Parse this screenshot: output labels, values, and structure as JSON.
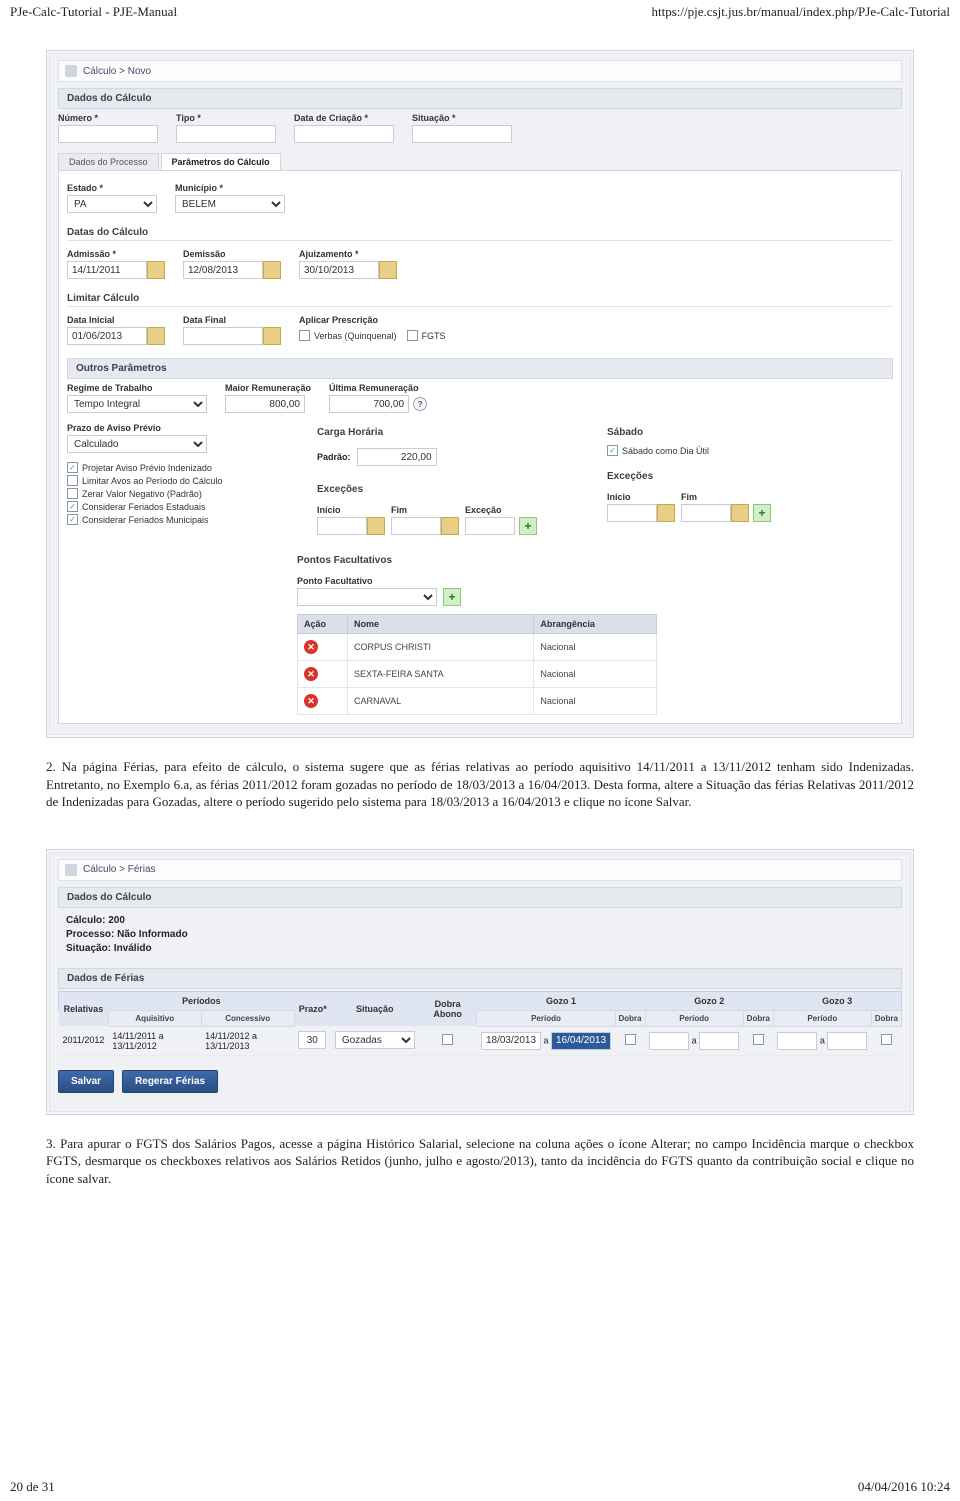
{
  "header": {
    "left": "PJe-Calc-Tutorial - PJE-Manual",
    "right": "https://pje.csjt.jus.br/manual/index.php/PJe-Calc-Tutorial"
  },
  "footer": {
    "left": "20 de 31",
    "right": "04/04/2016 10:24"
  },
  "shot1": {
    "breadcrumb": "Cálculo > Novo",
    "panel_dados": "Dados do Cálculo",
    "lbl_numero": "Número *",
    "lbl_tipo": "Tipo *",
    "lbl_datacriacao": "Data de Criação *",
    "lbl_situacao": "Situação *",
    "tab_dados_processo": "Dados do Processo",
    "tab_parametros": "Parâmetros do Cálculo",
    "lbl_estado": "Estado *",
    "val_estado": "PA",
    "lbl_municipio": "Município *",
    "val_municipio": "BELEM",
    "sub_datas": "Datas do Cálculo",
    "lbl_admissao": "Admissão *",
    "val_admissao": "14/11/2011",
    "lbl_demissao": "Demissão",
    "val_demissao": "12/08/2013",
    "lbl_ajuizamento": "Ajuizamento *",
    "val_ajuizamento": "30/10/2013",
    "sub_limitar": "Limitar Cálculo",
    "lbl_datainicial": "Data Inicial",
    "val_datainicial": "01/06/2013",
    "lbl_datafinal": "Data Final",
    "lbl_aplicar_presc": "Aplicar Prescrição",
    "cb_verbas": "Verbas (Quinquenal)",
    "cb_fgts": "FGTS",
    "panel_outros": "Outros Parâmetros",
    "lbl_regime": "Regime de Trabalho",
    "val_regime": "Tempo Integral",
    "lbl_maior_rem": "Maior Remuneração",
    "val_maior_rem": "800,00",
    "lbl_ultima_rem": "Última Remuneração",
    "val_ultima_rem": "700,00",
    "lbl_prazo_aviso": "Prazo de Aviso Prévio",
    "val_prazo_aviso": "Calculado",
    "cb_projetar": "Projetar Aviso Prévio Indenizado",
    "cb_limitar_avos": "Limitar Avos ao Período do Cálculo",
    "cb_zerar": "Zerar Valor Negativo (Padrão)",
    "cb_feriados_est": "Considerar Feriados Estaduais",
    "cb_feriados_mun": "Considerar Feriados Municipais",
    "sub_carga": "Carga Horária",
    "lbl_padrao": "Padrão:",
    "val_padrao": "220,00",
    "sub_excecoes": "Exceções",
    "lbl_inicio": "Início",
    "lbl_fim": "Fim",
    "lbl_excecao": "Exceção",
    "sub_sabado": "Sábado",
    "cb_sabado_util": "Sábado como Dia Útil",
    "sub_pontos": "Pontos Facultativos",
    "lbl_ponto": "Ponto Facultativo",
    "tbl_hdr_acao": "Ação",
    "tbl_hdr_nome": "Nome",
    "tbl_hdr_abrang": "Abrangência",
    "pontos_rows": [
      {
        "nome": "CORPUS CHRISTI",
        "abrang": "Nacional"
      },
      {
        "nome": "SEXTA-FEIRA SANTA",
        "abrang": "Nacional"
      },
      {
        "nome": "CARNAVAL",
        "abrang": "Nacional"
      }
    ]
  },
  "para1": "2. Na página Férias, para efeito de cálculo, o sistema sugere que as férias relativas ao período aquisitivo 14/11/2011 a 13/11/2012 tenham sido Indenizadas. Entretanto, no Exemplo 6.a, as férias 2011/2012 foram gozadas no período de 18/03/2013 a 16/04/2013. Desta forma, altere a Situação das férias Relativas 2011/2012 de Indenizadas para Gozadas, altere o período sugerido pelo sistema para 18/03/2013 a 16/04/2013 e clique no ícone Salvar.",
  "shot2": {
    "breadcrumb": "Cálculo > Férias",
    "panel_dados": "Dados do Cálculo",
    "ln1": "Cálculo: 200",
    "ln2": "Processo: Não Informado",
    "ln3": "Situação: Inválido",
    "panel_ferias": "Dados de Férias",
    "hdr_relativas": "Relativas",
    "hdr_periodos": "Períodos",
    "hdr_prazo": "Prazo*",
    "hdr_sit": "Situação",
    "hdr_dobra_abono": "Dobra Abono",
    "hdr_gozo1": "Gozo 1",
    "hdr_gozo2": "Gozo 2",
    "hdr_gozo3": "Gozo 3",
    "sub_aquisitivo": "Aquisitivo",
    "sub_concessivo": "Concessivo",
    "sub_periodo": "Período",
    "sub_dobra": "Dobra",
    "row_rel": "2011/2012",
    "row_aq": "14/11/2011 a 13/11/2012",
    "row_conc": "14/11/2012 a 13/11/2013",
    "row_prazo": "30",
    "row_sit": "Gozadas",
    "row_g1_ini": "18/03/2013",
    "row_a": "a",
    "row_g1_fim": "16/04/2013",
    "btn_salvar": "Salvar",
    "btn_regerar": "Regerar Férias"
  },
  "para2": "3. Para apurar o FGTS dos Salários Pagos, acesse a página Histórico Salarial, selecione na coluna ações o ícone Alterar; no campo Incidência marque o checkbox FGTS, desmarque os checkboxes relativos aos Salários Retidos (junho, julho e agosto/2013), tanto da incidência do FGTS quanto da contribuição social e clique no ícone salvar."
}
